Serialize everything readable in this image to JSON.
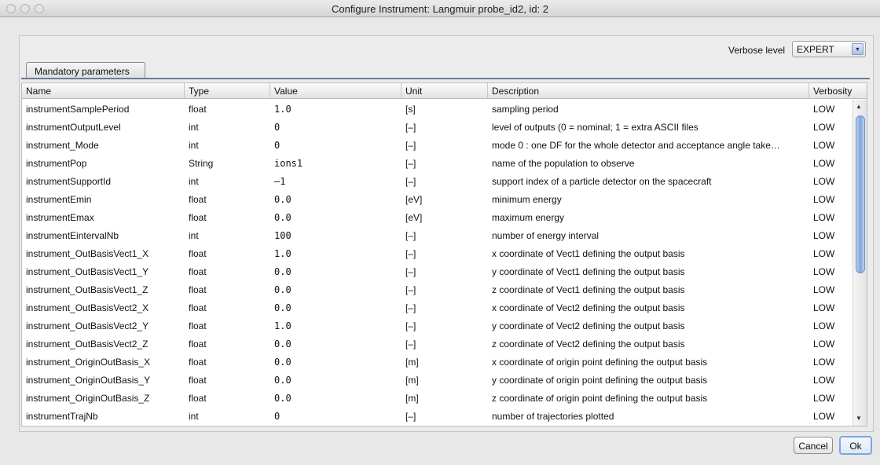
{
  "window": {
    "title": "Configure Instrument: Langmuir probe_id2, id: 2"
  },
  "toolbar": {
    "verbose_label": "Verbose level",
    "verbose_value": "EXPERT",
    "dropdown_icon": "chevron-updown-icon"
  },
  "tabs": [
    {
      "label": "Mandatory parameters",
      "selected": true
    }
  ],
  "table": {
    "columns": [
      "Name",
      "Type",
      "Value",
      "Unit",
      "Description",
      "Verbosity"
    ],
    "rows": [
      [
        "instrumentSamplePeriod",
        "float",
        "1.0",
        "[s]",
        "sampling period",
        "LOW"
      ],
      [
        "instrumentOutputLevel",
        "int",
        "0",
        "[–]",
        "level of outputs (0 = nominal; 1 = extra ASCII files",
        "LOW"
      ],
      [
        "instrument_Mode",
        "int",
        "0",
        "[–]",
        "mode 0 : one DF for the whole detector and acceptance angle take…",
        "LOW"
      ],
      [
        "instrumentPop",
        "String",
        "ions1",
        "[–]",
        "name of the population to observe",
        "LOW"
      ],
      [
        "instrumentSupportId",
        "int",
        "–1",
        "[–]",
        "support index of a particle detector on the spacecraft",
        "LOW"
      ],
      [
        "instrumentEmin",
        "float",
        "0.0",
        "[eV]",
        "minimum energy",
        "LOW"
      ],
      [
        "instrumentEmax",
        "float",
        "0.0",
        "[eV]",
        "maximum energy",
        "LOW"
      ],
      [
        "instrumentEintervalNb",
        "int",
        "100",
        "[–]",
        "number of energy interval",
        "LOW"
      ],
      [
        "instrument_OutBasisVect1_X",
        "float",
        "1.0",
        "[–]",
        "x coordinate of Vect1 defining the output basis",
        "LOW"
      ],
      [
        "instrument_OutBasisVect1_Y",
        "float",
        "0.0",
        "[–]",
        "y coordinate of Vect1 defining the output basis",
        "LOW"
      ],
      [
        "instrument_OutBasisVect1_Z",
        "float",
        "0.0",
        "[–]",
        "z coordinate of Vect1 defining the output basis",
        "LOW"
      ],
      [
        "instrument_OutBasisVect2_X",
        "float",
        "0.0",
        "[–]",
        "x coordinate of Vect2 defining the output basis",
        "LOW"
      ],
      [
        "instrument_OutBasisVect2_Y",
        "float",
        "1.0",
        "[–]",
        "y coordinate of Vect2 defining the output basis",
        "LOW"
      ],
      [
        "instrument_OutBasisVect2_Z",
        "float",
        "0.0",
        "[–]",
        "z coordinate of Vect2 defining the output basis",
        "LOW"
      ],
      [
        "instrument_OriginOutBasis_X",
        "float",
        "0.0",
        "[m]",
        "x coordinate of origin point defining the output basis",
        "LOW"
      ],
      [
        "instrument_OriginOutBasis_Y",
        "float",
        "0.0",
        "[m]",
        "y coordinate of origin point defining the output basis",
        "LOW"
      ],
      [
        "instrument_OriginOutBasis_Z",
        "float",
        "0.0",
        "[m]",
        "z coordinate of origin point defining the output basis",
        "LOW"
      ],
      [
        "instrumentTrajNb",
        "int",
        "0",
        "[–]",
        "number of trajectories plotted",
        "LOW"
      ]
    ]
  },
  "scrollbar": {
    "up_icon": "arrow-up-icon",
    "down_icon": "arrow-down-icon"
  },
  "buttons": {
    "cancel": "Cancel",
    "ok": "Ok"
  }
}
